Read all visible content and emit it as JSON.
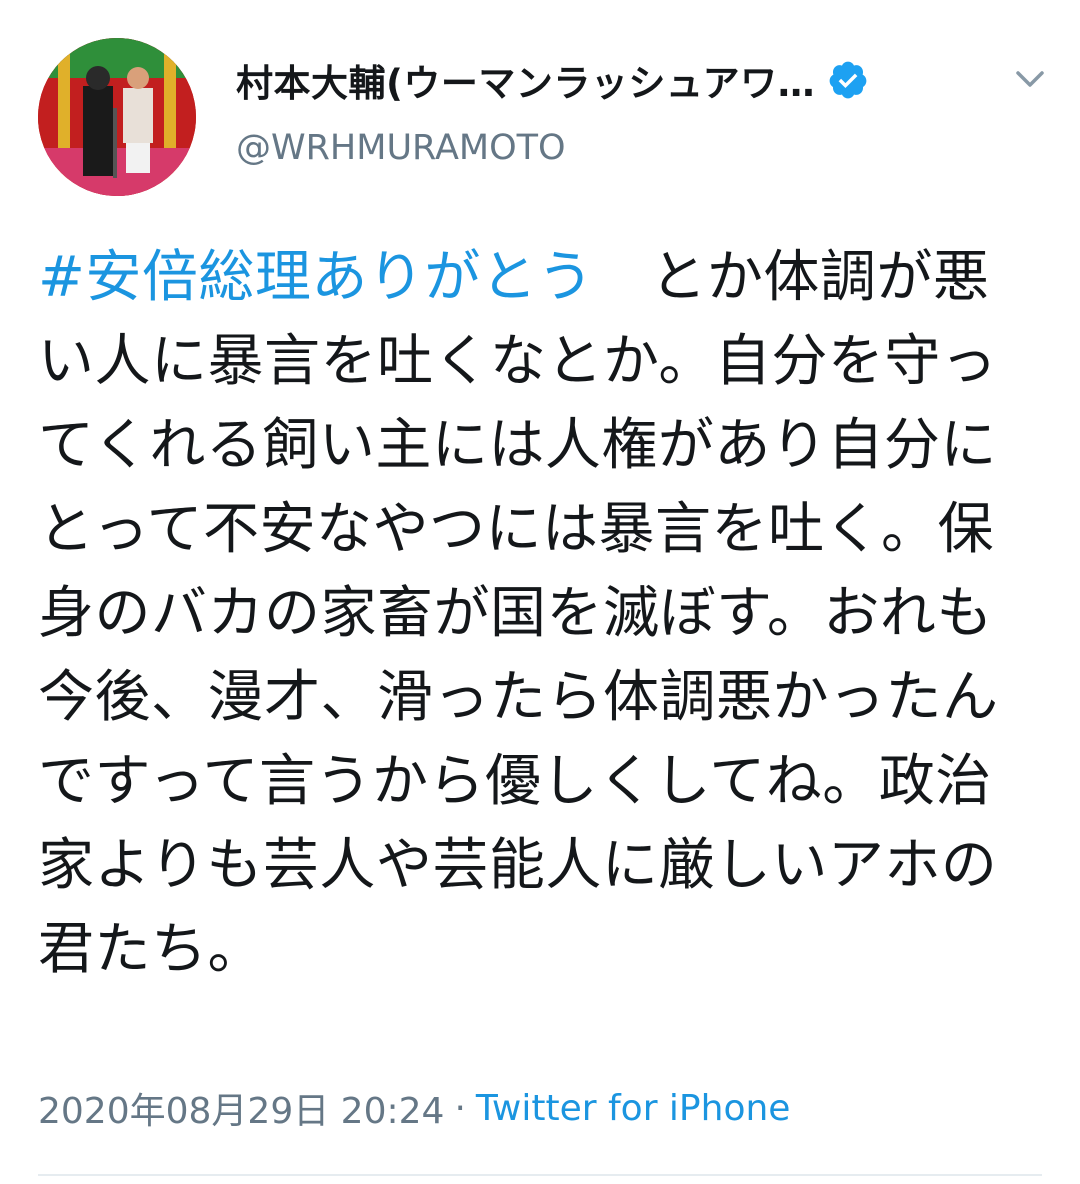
{
  "tweet": {
    "author": {
      "display_name": "村本大輔(ウーマンラッシュアワ…",
      "handle": "@WRHMURAMOTO",
      "verified": true
    },
    "icons": {
      "verified": "verified-badge-icon",
      "menu": "chevron-down-icon"
    },
    "body": {
      "hashtag": "#安倍総理ありがとう",
      "text": "　とか体調が悪い人に暴言を吐くなとか。自分を守ってくれる飼い主には人権があり自分にとって不安なやつには暴言を吐く。保身のバカの家畜が国を滅ぼす。おれも今後、漫才、滑ったら体調悪かったんですって言うから優しくしてね。政治家よりも芸人や芸能人に厳しいアホの君たち。"
    },
    "meta": {
      "timestamp": "2020年08月29日 20:24",
      "separator": "·",
      "source": "Twitter for iPhone"
    },
    "colors": {
      "link": "#1b95e0",
      "secondary": "#657786",
      "verified": "#1da1f2"
    }
  }
}
